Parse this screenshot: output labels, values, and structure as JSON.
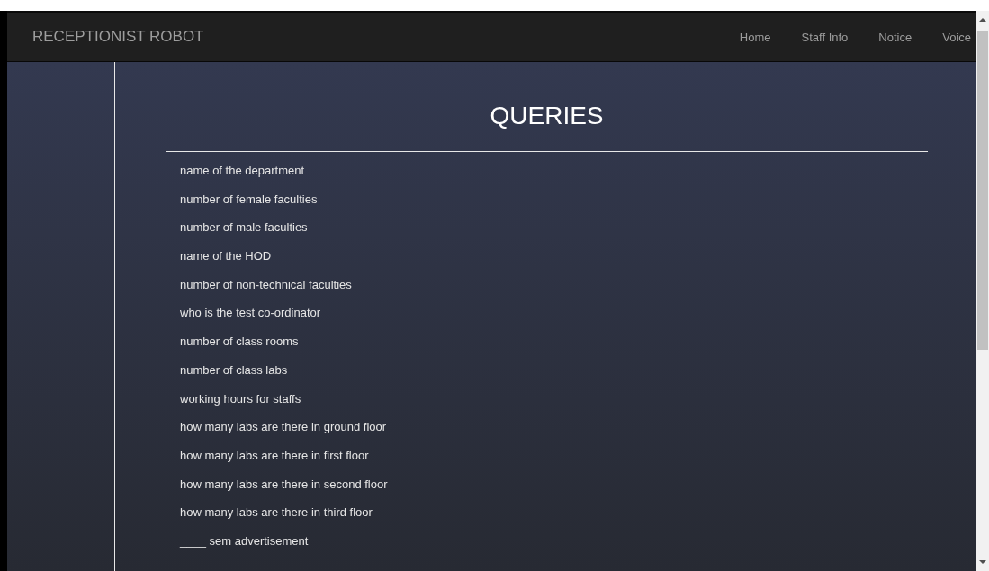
{
  "navbar": {
    "brand": "RECEPTIONIST ROBOT",
    "links": [
      {
        "label": "Home"
      },
      {
        "label": "Staff Info"
      },
      {
        "label": "Notice"
      },
      {
        "label": "Voice"
      }
    ]
  },
  "content": {
    "title": "QUERIES",
    "queries": [
      "name of the department",
      "number of female faculties",
      "number of male faculties",
      "name of the HOD",
      "number of non-technical faculties",
      "who is the test co-ordinator",
      "number of class rooms",
      "number of class labs",
      "working hours for staffs",
      "how many labs are there in ground floor",
      "how many labs are there in first floor",
      "how many labs are there in second floor",
      "how many labs are there in third floor",
      "____ sem advertisement"
    ]
  }
}
